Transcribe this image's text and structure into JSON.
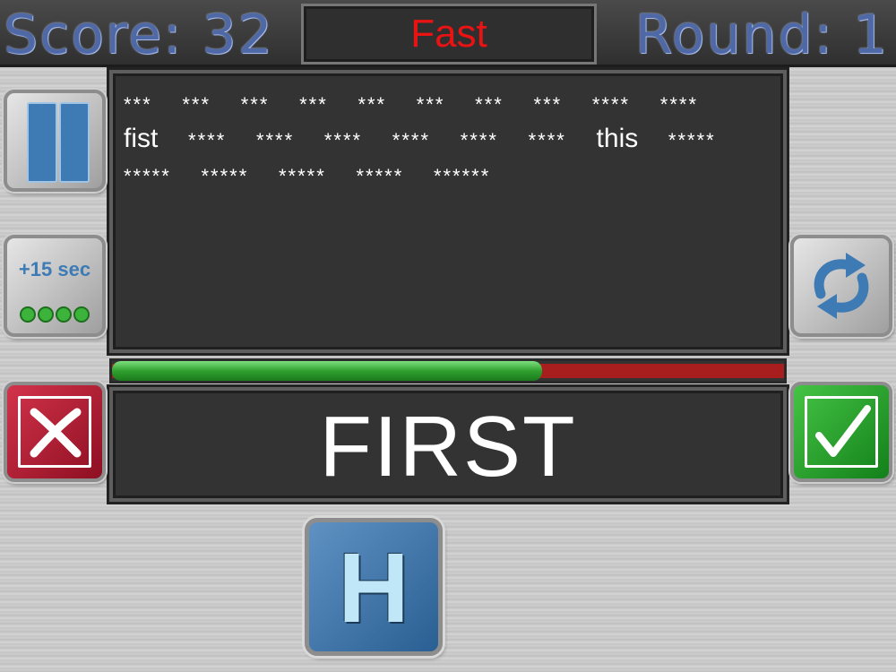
{
  "header": {
    "score_text": "Score: 32",
    "speed_label": "Fast",
    "round_text": "Round: 1"
  },
  "words_list": [
    {
      "text": "***",
      "kind": "star"
    },
    {
      "text": "***",
      "kind": "star"
    },
    {
      "text": "***",
      "kind": "star"
    },
    {
      "text": "***",
      "kind": "star"
    },
    {
      "text": "***",
      "kind": "star"
    },
    {
      "text": "***",
      "kind": "star"
    },
    {
      "text": "***",
      "kind": "star"
    },
    {
      "text": "***",
      "kind": "star"
    },
    {
      "text": "****",
      "kind": "star"
    },
    {
      "text": "****",
      "kind": "star"
    },
    {
      "text": "fist",
      "kind": "word"
    },
    {
      "text": "****",
      "kind": "star"
    },
    {
      "text": "****",
      "kind": "star"
    },
    {
      "text": "****",
      "kind": "star"
    },
    {
      "text": "****",
      "kind": "star"
    },
    {
      "text": "****",
      "kind": "star"
    },
    {
      "text": "****",
      "kind": "star"
    },
    {
      "text": "this",
      "kind": "word"
    },
    {
      "text": "*****",
      "kind": "star"
    },
    {
      "text": "*****",
      "kind": "star"
    },
    {
      "text": "*****",
      "kind": "star"
    },
    {
      "text": "*****",
      "kind": "star"
    },
    {
      "text": "*****",
      "kind": "star"
    },
    {
      "text": "******",
      "kind": "star"
    }
  ],
  "timer": {
    "remaining_fraction": 0.64,
    "fill_color": "#2fa02f",
    "empty_color": "#a81d1d"
  },
  "target_word": "FIRST",
  "buttons": {
    "pause_icon": "pause-icon",
    "add_time_label": "+15 sec",
    "add_time_charges": 4,
    "refresh_icon": "refresh-icon",
    "reject_icon": "x-icon",
    "accept_icon": "checkmark-icon",
    "hint_letter": "H"
  },
  "colors": {
    "speed": "#ea1313",
    "score": "#4f68a6",
    "accent_blue": "#3e7bb5",
    "reject": "#b01d33",
    "accept": "#22a02a"
  }
}
